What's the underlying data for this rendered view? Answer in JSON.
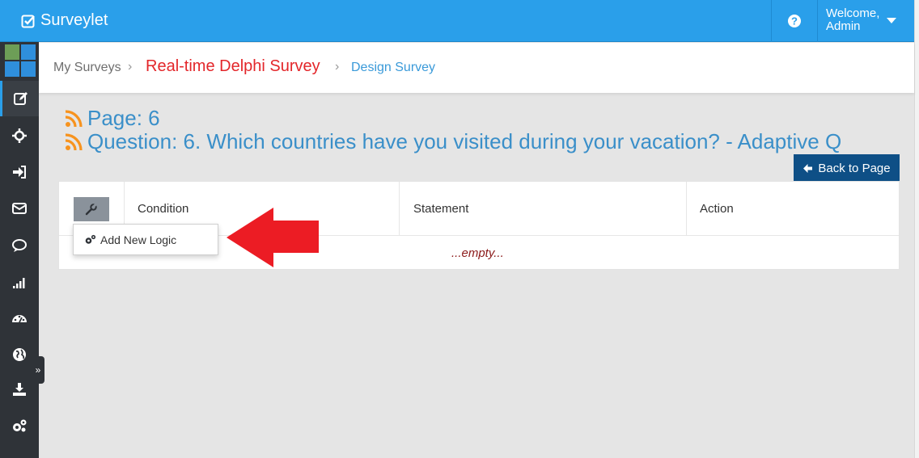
{
  "app": {
    "name": "Surveylet"
  },
  "topbar": {
    "welcome_line1": "Welcome,",
    "welcome_line2": "Admin"
  },
  "breadcrumb": {
    "item1": "My Surveys",
    "item2": "Real-time Delphi Survey",
    "item3": "Design Survey"
  },
  "headings": {
    "page": "Page: 6",
    "question": "Question: 6. Which countries have you visited during your vacation? - Adaptive Q"
  },
  "back_button": {
    "label": "Back to Page"
  },
  "table": {
    "columns": [
      "Condition",
      "Statement",
      "Action"
    ],
    "empty_text": "...empty..."
  },
  "dropdown": {
    "items": [
      "Add New Logic"
    ]
  },
  "colors": {
    "topbar": "#2a9fea",
    "sidebar": "#2f3338",
    "heading": "#3a8fc9",
    "survey_title": "#e3262a",
    "back_button": "#0e4f86",
    "annotation_arrow": "#ec1c24",
    "rss_icon": "#f7931e"
  }
}
